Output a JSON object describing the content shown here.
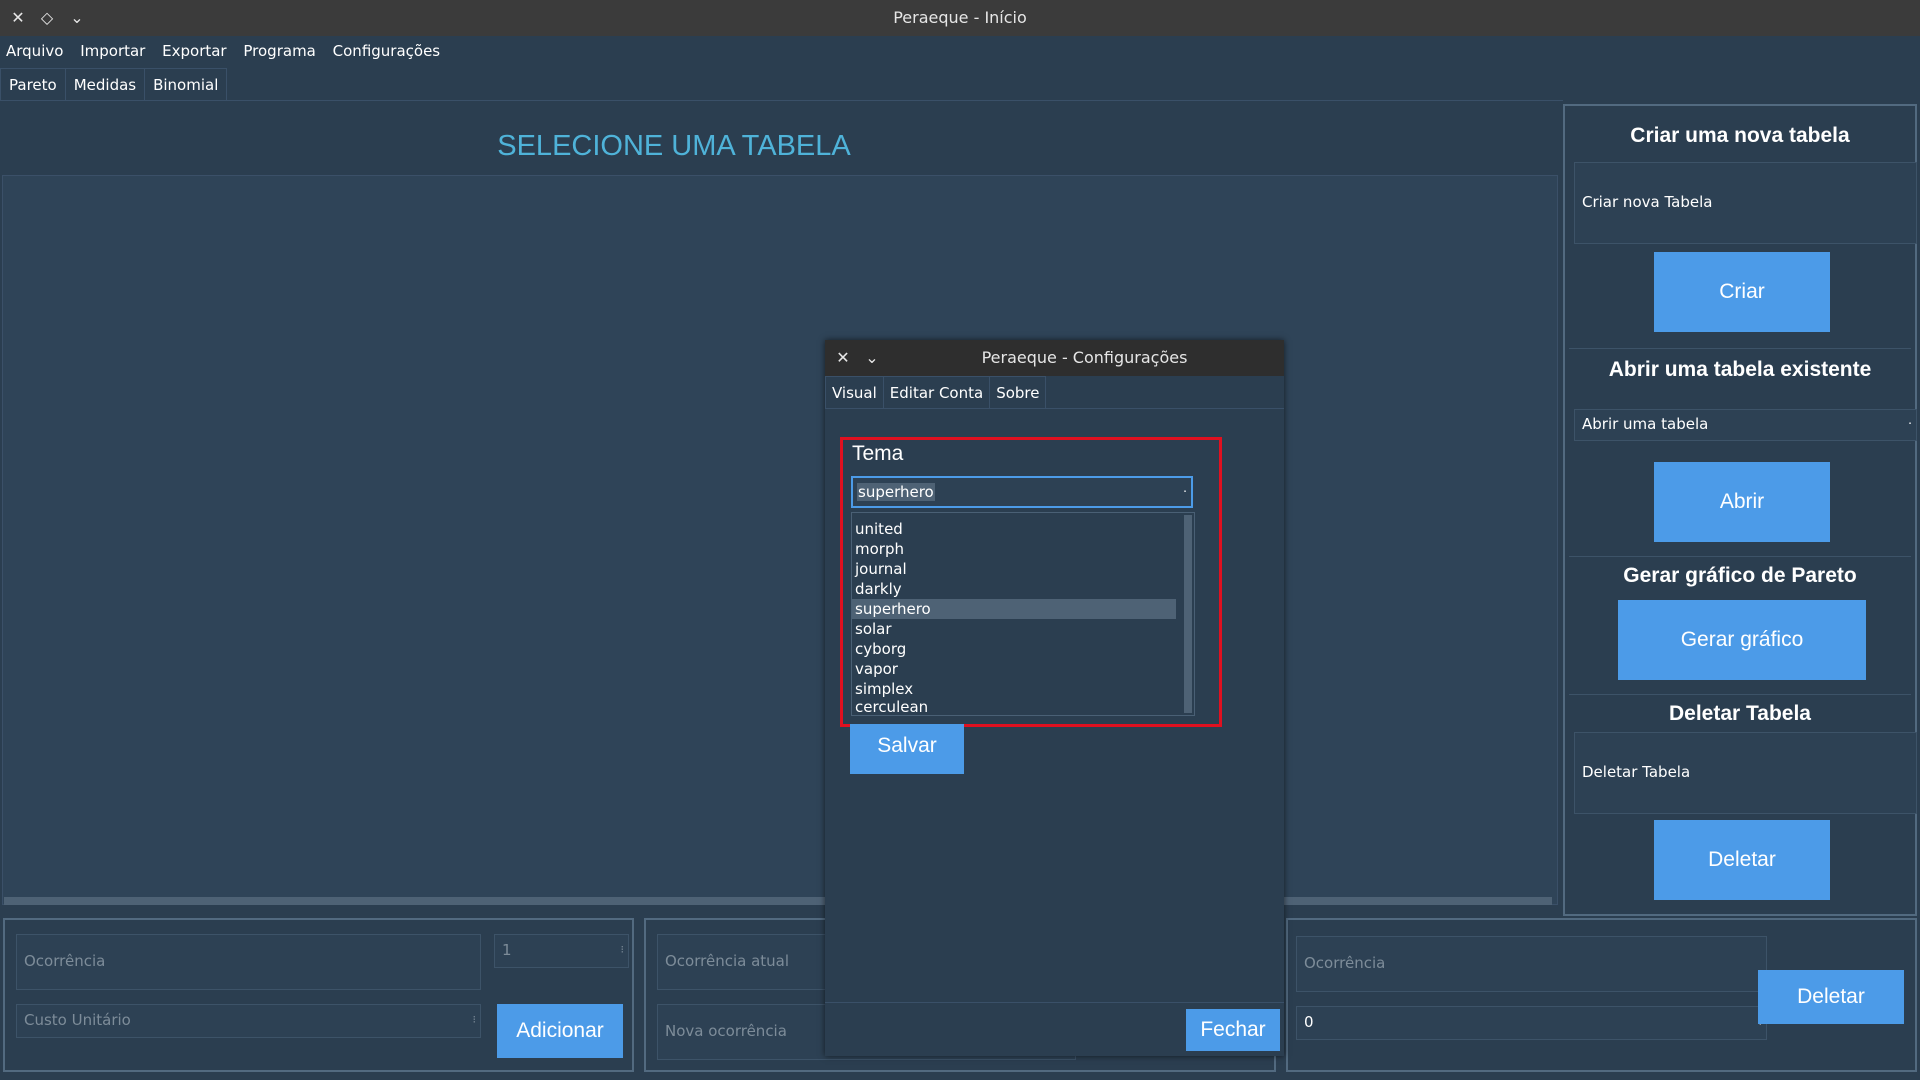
{
  "window": {
    "title": "Peraeque - Início"
  },
  "menu": [
    "Arquivo",
    "Importar",
    "Exportar",
    "Programa",
    "Configurações"
  ],
  "tabs": [
    "Pareto",
    "Medidas",
    "Binomial"
  ],
  "heading": "SELECIONE UMA TABELA",
  "right_panel": {
    "create_title": "Criar uma nova tabela",
    "create_input": "Criar nova Tabela",
    "create_button": "Criar",
    "open_title": "Abrir uma tabela existente",
    "open_select": "Abrir uma tabela",
    "open_button": "Abrir",
    "chart_title": "Gerar gráfico de Pareto",
    "chart_button": "Gerar gráfico",
    "delete_title": "Deletar Tabela",
    "delete_input": "Deletar Tabela",
    "delete_button": "Deletar"
  },
  "bottom": {
    "left": {
      "occurrence_placeholder": "Ocorrência",
      "quantity_value": "1",
      "cost_placeholder": "Custo Unitário",
      "add_button": "Adicionar"
    },
    "middle": {
      "current_placeholder": "Ocorrência atual",
      "new_placeholder": "Nova ocorrência"
    },
    "right": {
      "occurrence_placeholder": "Ocorrência",
      "number_value": "0",
      "delete_button": "Deletar"
    }
  },
  "dialog": {
    "title": "Peraeque - Configurações",
    "tabs": [
      "Visual",
      "Editar Conta",
      "Sobre"
    ],
    "theme_label": "Tema",
    "theme_value": "superhero",
    "theme_options": [
      "united",
      "morph",
      "journal",
      "darkly",
      "superhero",
      "solar",
      "cyborg",
      "vapor",
      "simplex",
      "cerculean"
    ],
    "selected_option": "superhero",
    "save_button": "Salvar",
    "close_button": "Fechar"
  },
  "colors": {
    "background": "#2b3e50",
    "accent": "#4c9be8",
    "heading": "#4fb3d9",
    "highlight_box": "#e01020"
  }
}
